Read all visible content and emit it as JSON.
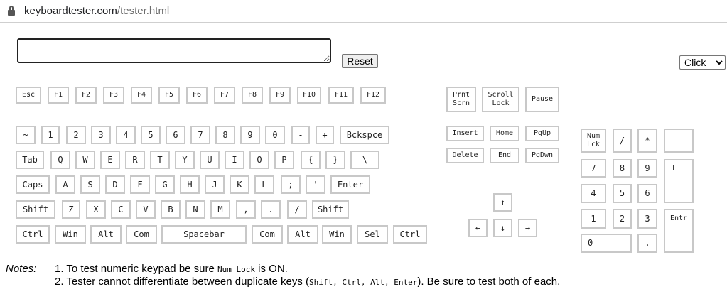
{
  "browser": {
    "url_domain": "keyboardtester.com",
    "url_path": "/tester.html"
  },
  "controls": {
    "reset_label": "Reset",
    "mode_selected": "Click"
  },
  "keys": {
    "esc": "Esc",
    "f1": "F1",
    "f2": "F2",
    "f3": "F3",
    "f4": "F4",
    "f5": "F5",
    "f6": "F6",
    "f7": "F7",
    "f8": "F8",
    "f9": "F9",
    "f10": "F10",
    "f11": "F11",
    "f12": "F12",
    "tilde": "~",
    "k1": "1",
    "k2": "2",
    "k3": "3",
    "k4": "4",
    "k5": "5",
    "k6": "6",
    "k7": "7",
    "k8": "8",
    "k9": "9",
    "k0": "0",
    "minus": "-",
    "plus": "+",
    "backspace": "Bckspce",
    "tab": "Tab",
    "q": "Q",
    "w": "W",
    "e": "E",
    "r": "R",
    "t": "T",
    "y": "Y",
    "u": "U",
    "i": "I",
    "o": "O",
    "p": "P",
    "lbrace": "{",
    "rbrace": "}",
    "backslash": "\\",
    "caps": "Caps",
    "a": "A",
    "s": "S",
    "d": "D",
    "f": "F",
    "g": "G",
    "h": "H",
    "j": "J",
    "k": "K",
    "l": "L",
    "semicolon": ";",
    "quote": "'",
    "enter": "Enter",
    "shift_left": "Shift",
    "z": "Z",
    "x": "X",
    "c": "C",
    "v": "V",
    "b": "B",
    "n": "N",
    "m": "M",
    "comma": ",",
    "period": ".",
    "slash": "/",
    "shift_right": "Shift",
    "ctrl_left": "Ctrl",
    "win_left": "Win",
    "alt_left": "Alt",
    "com_left": "Com",
    "spacebar": "Spacebar",
    "com_right": "Com",
    "alt_right": "Alt",
    "win_right": "Win",
    "sel": "Sel",
    "ctrl_right": "Ctrl",
    "print_screen": "Prnt\nScrn",
    "scroll_lock": "Scroll\nLock",
    "pause": "Pause",
    "insert": "Insert",
    "home": "Home",
    "pgup": "PgUp",
    "delete": "Delete",
    "end": "End",
    "pgdwn": "PgDwn",
    "arrow_up": "↑",
    "arrow_left": "←",
    "arrow_down": "↓",
    "arrow_right": "→",
    "numlock": "Num\nLck",
    "num_divide": "/",
    "num_multiply": "*",
    "num_minus": "-",
    "num7": "7",
    "num8": "8",
    "num9": "9",
    "num_plus": "+",
    "num4": "4",
    "num5": "5",
    "num6": "6",
    "num1": "1",
    "num2": "2",
    "num3": "3",
    "num_enter": "Entr",
    "num0": "0",
    "num_decimal": "."
  },
  "notes": {
    "label": "Notes:",
    "n1_pre": "1. To test numeric keypad be sure ",
    "n1_code": "Num Lock",
    "n1_post": " is ON.",
    "n2_pre": "2. Tester cannot differentiate between duplicate keys (",
    "n2_code": "Shift, Ctrl, Alt, Enter",
    "n2_post": "). Be sure to test both of each."
  }
}
